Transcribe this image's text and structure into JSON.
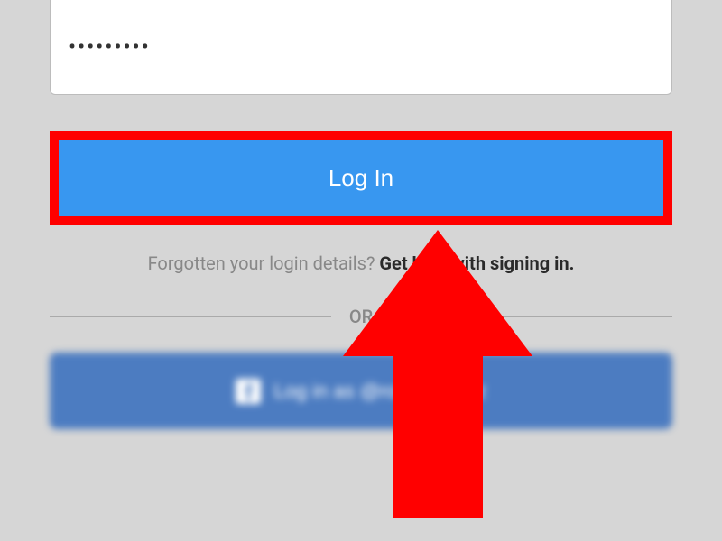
{
  "password": {
    "value": "•••••••••"
  },
  "login_button": {
    "label": "Log In"
  },
  "forgot": {
    "prompt": "Forgotten your login details? ",
    "link": "Get help with signing in."
  },
  "divider": {
    "label": "OR"
  },
  "facebook": {
    "label": "Log in as @rockwooddz",
    "icon_letter": "f"
  },
  "colors": {
    "accent": "#3897f0",
    "highlight": "#ff0000",
    "fb": "#4c7cc1"
  }
}
